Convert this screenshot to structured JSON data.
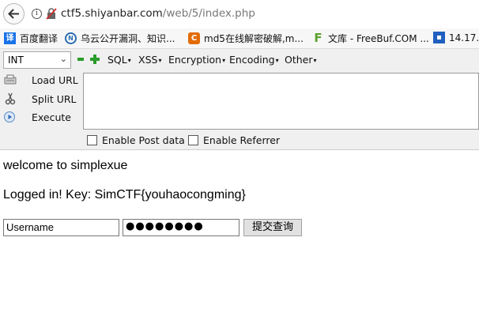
{
  "address_bar": {
    "url_host": "ctf5.shiyanbar.com",
    "url_path": "/web/5/index.php"
  },
  "bookmarks": [
    {
      "label": "百度翻译",
      "icon": "translate-icon",
      "color": "#1a73e8"
    },
    {
      "label": "乌云公开漏洞、知识...",
      "icon": "wooyun-icon",
      "color": "#2b6cb0"
    },
    {
      "label": "md5在线解密破解,m...",
      "icon": "cmd5-icon",
      "color": "#e36c09"
    },
    {
      "label": "文库 - FreeBuf.COM ...",
      "icon": "freebuf-icon",
      "color": "#5aa02c"
    },
    {
      "label": "14.17.",
      "icon": "bookmark-icon",
      "color": "#1f5fbf"
    }
  ],
  "hackbar": {
    "select_value": "INT",
    "menus": [
      "SQL",
      "XSS",
      "Encryption",
      "Encoding",
      "Other"
    ],
    "actions": [
      "Load URL",
      "Split URL",
      "Execute"
    ],
    "checkboxes": [
      "Enable Post data",
      "Enable Referrer"
    ]
  },
  "page": {
    "welcome": "welcome to simplexue",
    "key_line": "Logged in! Key: SimCTF{youhaocongming}",
    "username_value": "Username",
    "password_mask": "●●●●●●●●",
    "submit_label": "提交查询"
  },
  "colors": {
    "hackbar_bg": "#f0f0f0",
    "bookmarks_bg": "#f7f7f7",
    "plus_green": "#2a9d2a"
  }
}
